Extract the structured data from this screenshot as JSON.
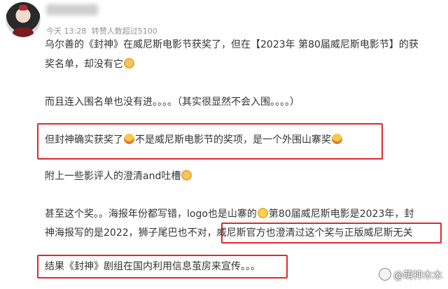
{
  "post": {
    "time": "今天 13:28",
    "repost_info": "转赞人数超过5100",
    "paragraphs": {
      "p1_line1": "乌尔善的《封神》在威尼斯电影节获奖了，但在【2023年 第80届威尼斯电影节】的获",
      "p1_line2": "奖名单，却没有它",
      "p2": "而且连入围名单也没有进。。。。（其实很显然不会入围。。。。）",
      "p3_a": "但封神确实获奖了",
      "p3_b": "不是威尼斯电影节的奖项，是一个外围山寨奖",
      "p4": "附上一些影评人的澄清and吐槽",
      "p5_line1_a": "甚至这个奖。。海报年份都写错，logo也是山寨的",
      "p5_line1_b": "第80届威尼斯电影是2023年，封",
      "p5_line2_a": "神海报写的是2022，狮子尾巴也不对，",
      "p5_line2_b": "威尼斯官方也澄清过这个奖与正版威尼斯无关",
      "p6": "结果《封神》剧组在国内利用信息茧房来宣传。。。"
    }
  },
  "watermark": {
    "text": "@萌神木木"
  },
  "icons": {
    "avatar": "avatar",
    "emoji_cat": "cat-emoji",
    "emoji_laugh": "laughing-tears-emoji",
    "emoji_smile": "smile-emoji"
  },
  "colors": {
    "highlight_box": "#e0282f",
    "meta_text": "#939393",
    "body_text": "#333333"
  }
}
